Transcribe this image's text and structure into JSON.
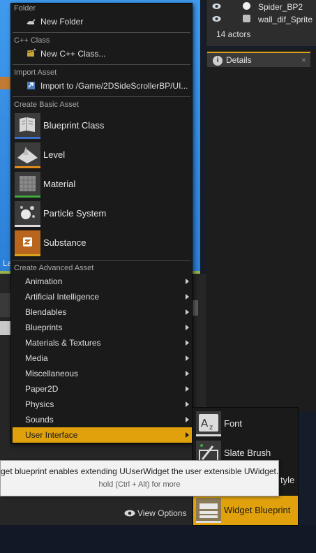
{
  "viewport": {
    "label": "La"
  },
  "outliner": {
    "rows": [
      {
        "name": "Spider_BP2"
      },
      {
        "name": "wall_dif_Sprite"
      }
    ],
    "actor_count": "14 actors"
  },
  "details_tab": {
    "icon": "i",
    "label": "Details",
    "close": "×"
  },
  "content_browser": {
    "view_options": "View Options"
  },
  "menu": {
    "folder_header": "Folder",
    "new_folder": "New Folder",
    "cpp_header": "C++ Class",
    "new_cpp": "New C++ Class...",
    "import_header": "Import Asset",
    "import_to": "Import to /Game/2DSideScrollerBP/UI...",
    "basic_header": "Create Basic Asset",
    "basic_assets": [
      {
        "label": "Blueprint Class",
        "accent": "#3a70c9"
      },
      {
        "label": "Level",
        "accent": "#e08a1e"
      },
      {
        "label": "Material",
        "accent": "#3fa83f"
      },
      {
        "label": "Particle System",
        "accent": "#dddddd"
      },
      {
        "label": "Substance",
        "accent": "#d9a21b"
      }
    ],
    "advanced_header": "Create Advanced Asset",
    "advanced": [
      "Animation",
      "Artificial Intelligence",
      "Blendables",
      "Blueprints",
      "Materials & Textures",
      "Media",
      "Miscellaneous",
      "Paper2D",
      "Physics",
      "Sounds",
      "User Interface"
    ],
    "active_item": "User Interface"
  },
  "submenu": {
    "items": [
      {
        "label": "Font"
      },
      {
        "label": "Slate Brush"
      },
      {
        "label": "Widget Blueprint"
      }
    ],
    "partial_label": "tyle",
    "active_item": "Widget Blueprint"
  },
  "tooltip": {
    "text": "get blueprint enables extending UUserWidget the user extensible UWidget.",
    "hint": "hold (Ctrl + Alt) for more"
  },
  "colors": {
    "accent": "#e0a10d",
    "menu_bg": "#1a1a1a"
  }
}
